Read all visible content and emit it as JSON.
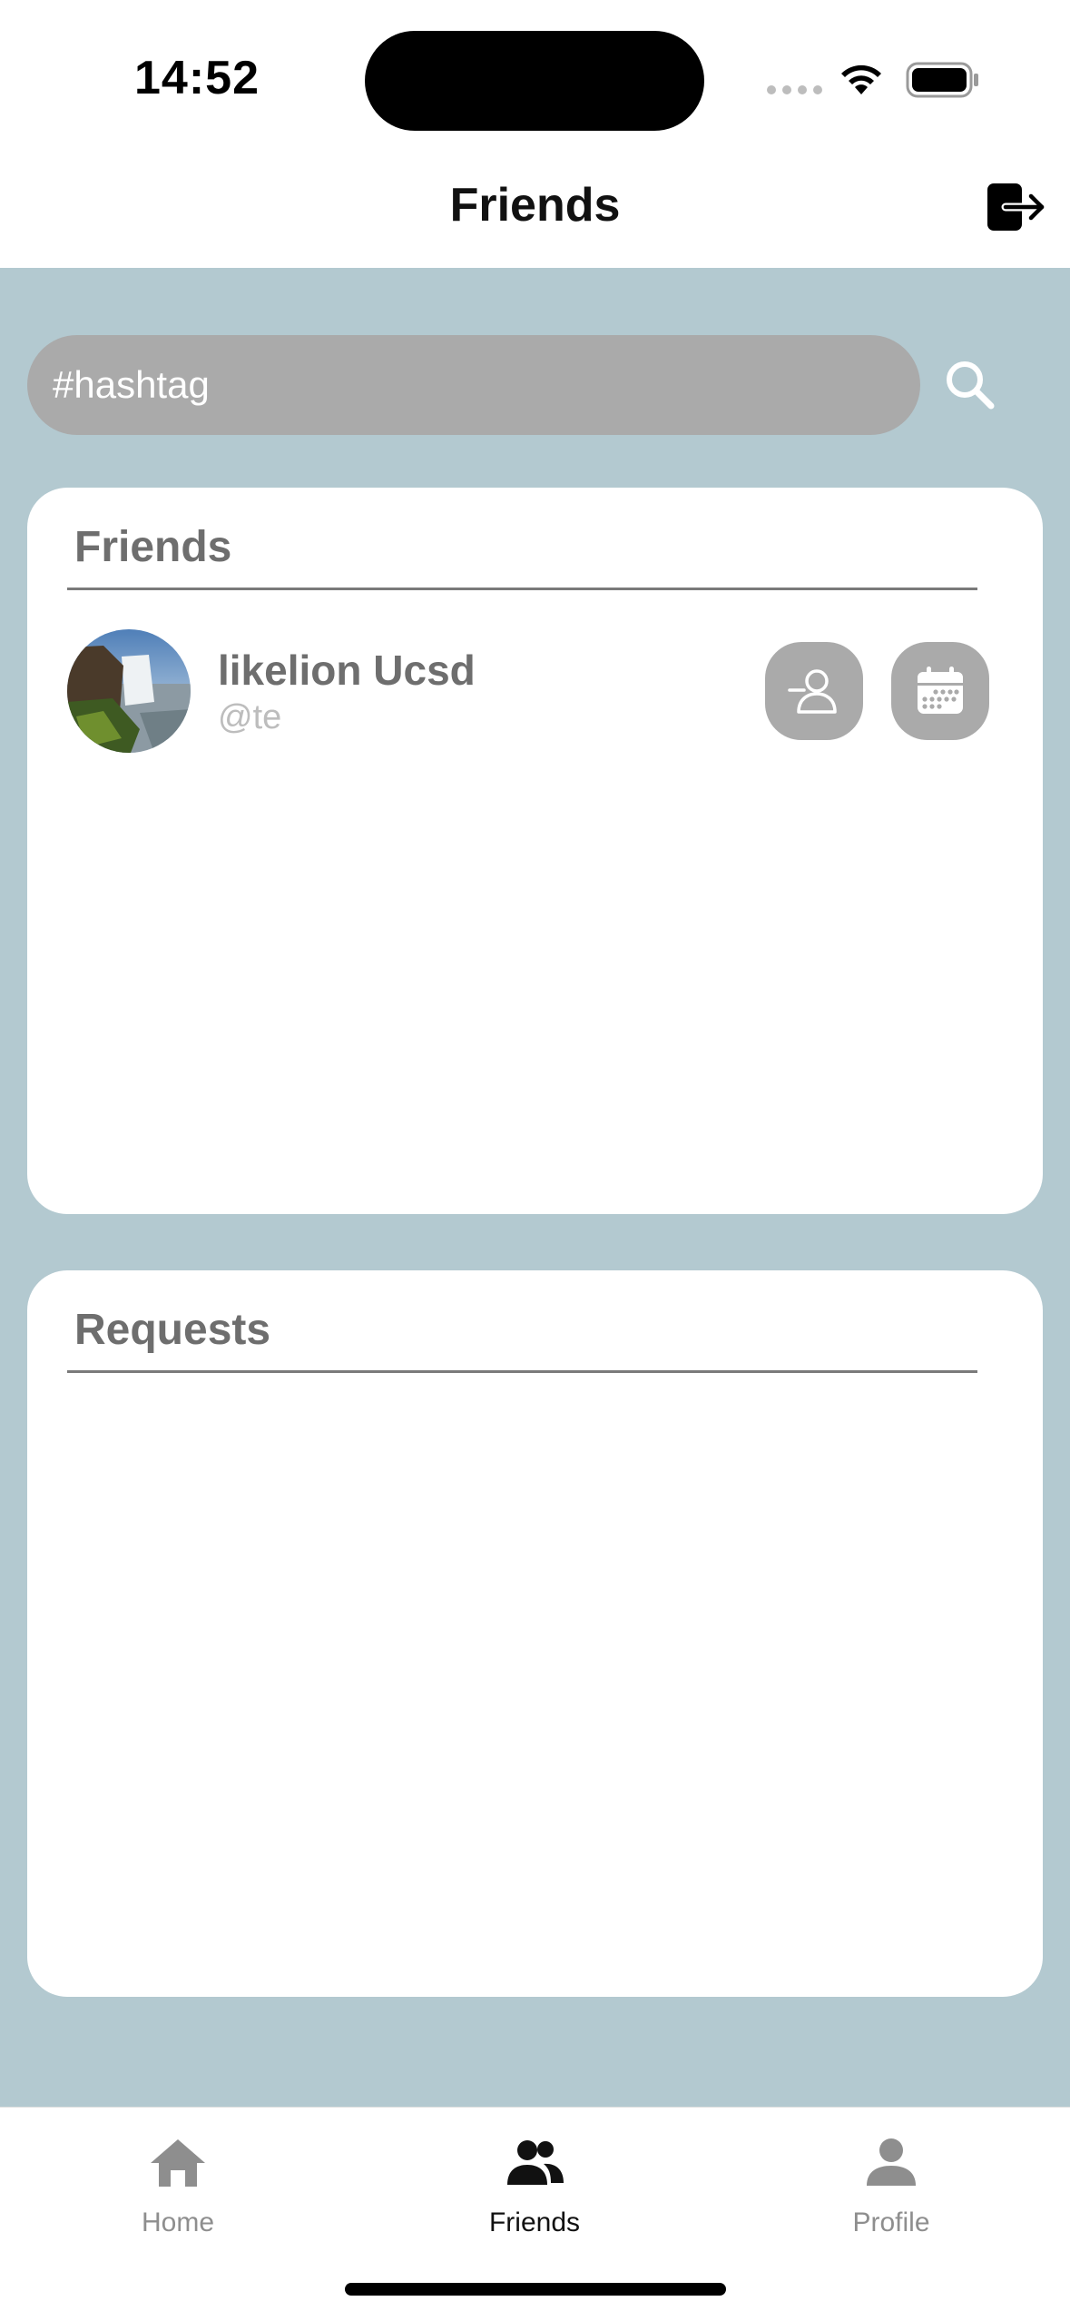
{
  "status_bar": {
    "time": "14:52"
  },
  "nav": {
    "title": "Friends",
    "logout_icon": "logout-icon"
  },
  "search": {
    "placeholder": "#hashtag",
    "button_icon": "search-icon"
  },
  "friends_card": {
    "title": "Friends",
    "items": [
      {
        "name": "likelion Ucsd",
        "handle": "@te",
        "avatar_icon": "avatar-photo",
        "actions": [
          "unfriend-icon",
          "calendar-icon"
        ]
      }
    ]
  },
  "requests_card": {
    "title": "Requests",
    "items": []
  },
  "tab_bar": {
    "tabs": [
      {
        "label": "Home",
        "icon": "home-icon",
        "active": false
      },
      {
        "label": "Friends",
        "icon": "friends-icon",
        "active": true
      },
      {
        "label": "Profile",
        "icon": "profile-icon",
        "active": false
      }
    ]
  },
  "colors": {
    "background": "#b3c9d0",
    "card": "#ffffff",
    "pill": "#aaaaaa",
    "title_text": "#6e6e6e"
  }
}
